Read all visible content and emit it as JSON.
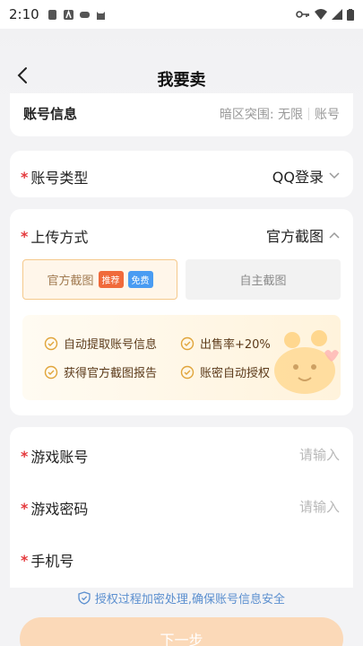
{
  "status_bar": {
    "time": "2:10"
  },
  "header": {
    "title": "我要卖"
  },
  "account_info": {
    "label": "账号信息",
    "hint_left": "暗区突围: 无限",
    "hint_right": "账号"
  },
  "account_type": {
    "label": "账号类型",
    "value": "QQ登录"
  },
  "upload": {
    "label": "上传方式",
    "value": "官方截图",
    "option_selected": {
      "label": "官方截图",
      "tag_recommend": "推荐",
      "tag_free": "免费"
    },
    "option_other": {
      "label": "自主截图"
    },
    "benefits": [
      "自动提取账号信息",
      "出售率+20%",
      "获得官方截图报告",
      "账密自动授权"
    ]
  },
  "fields": {
    "game_account": {
      "label": "游戏账号",
      "placeholder": "请输入"
    },
    "game_password": {
      "label": "游戏密码",
      "placeholder": "请输入"
    },
    "phone": {
      "label": "手机号",
      "placeholder": ""
    }
  },
  "security_note": "授权过程加密处理,确保账号信息安全",
  "next_button": "下一步",
  "colors": {
    "required": "#e4393c",
    "accent_orange": "#f06a3b",
    "accent_blue": "#4a9cf2",
    "button_disabled": "#fbd9b8"
  }
}
